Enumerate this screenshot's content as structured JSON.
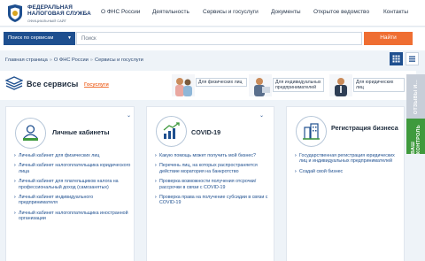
{
  "header": {
    "brand_line1": "ФЕДЕРАЛЬНАЯ",
    "brand_line2": "НАЛОГОВАЯ СЛУЖБА",
    "brand_line3": "ОФИЦИАЛЬНЫЙ САЙТ",
    "logo_icon": "fns-emblem-icon",
    "nav": [
      "О ФНС России",
      "Деятельность",
      "Сервисы и госуслуги",
      "Документы",
      "Открытое ведомство",
      "Контакты"
    ]
  },
  "search": {
    "scope_label": "Поиск по сервисам",
    "scope_icon": "chevron-down-icon",
    "placeholder": "Поиск",
    "button_label": "Найти"
  },
  "breadcrumb": [
    "Главная страница",
    "О ФНС России",
    "Сервисы и госуслуги"
  ],
  "services_bar": {
    "title": "Все сервисы",
    "gosuslugi_tab": "Госуслуги",
    "audience": [
      {
        "label": "Для физических лиц",
        "icon": "individuals-photo"
      },
      {
        "label": "Для индивидуальных предпринимателей",
        "icon": "entrepreneurs-photo"
      },
      {
        "label": "Для юридических лиц",
        "icon": "legal-entities-photo"
      }
    ]
  },
  "cards": [
    {
      "title": "Личные кабинеты",
      "icon": "personal-account-icon",
      "links": [
        "Личный кабинет для физических лиц",
        "Личный кабинет налогоплательщика юридического лица",
        "Личный кабинет для плательщиков налога на профессиональный доход (самозанятых)",
        "Личный кабинет индивидуального предпринимателя",
        "Личный кабинет налогоплательщика иностранной организации"
      ]
    },
    {
      "title": "COVID-19",
      "icon": "covid-chart-icon",
      "links": [
        "Какую помощь может получить мой бизнес?",
        "Перечень лиц, на которых распространяется действие моратория на банкротство",
        "Проверка возможности получения отсрочки/рассрочки в связи с COVID-19",
        "Проверка права на получение субсидии в связи с COVID-19"
      ]
    },
    {
      "title": "Регистрация бизнеса",
      "icon": "business-registration-icon",
      "links": [
        "Государственная регистрация юридических лиц и индивидуальных предпринимателей",
        "Создай свой бизнес"
      ]
    }
  ],
  "side_tabs": {
    "gray_label": "ОТЗЫВЫ И...",
    "green_label": "ВАШ КОНТРОЛЬ"
  },
  "colors": {
    "brand_blue": "#1e4f8f",
    "accent_orange": "#ef6e32",
    "green": "#3f9a3d"
  }
}
